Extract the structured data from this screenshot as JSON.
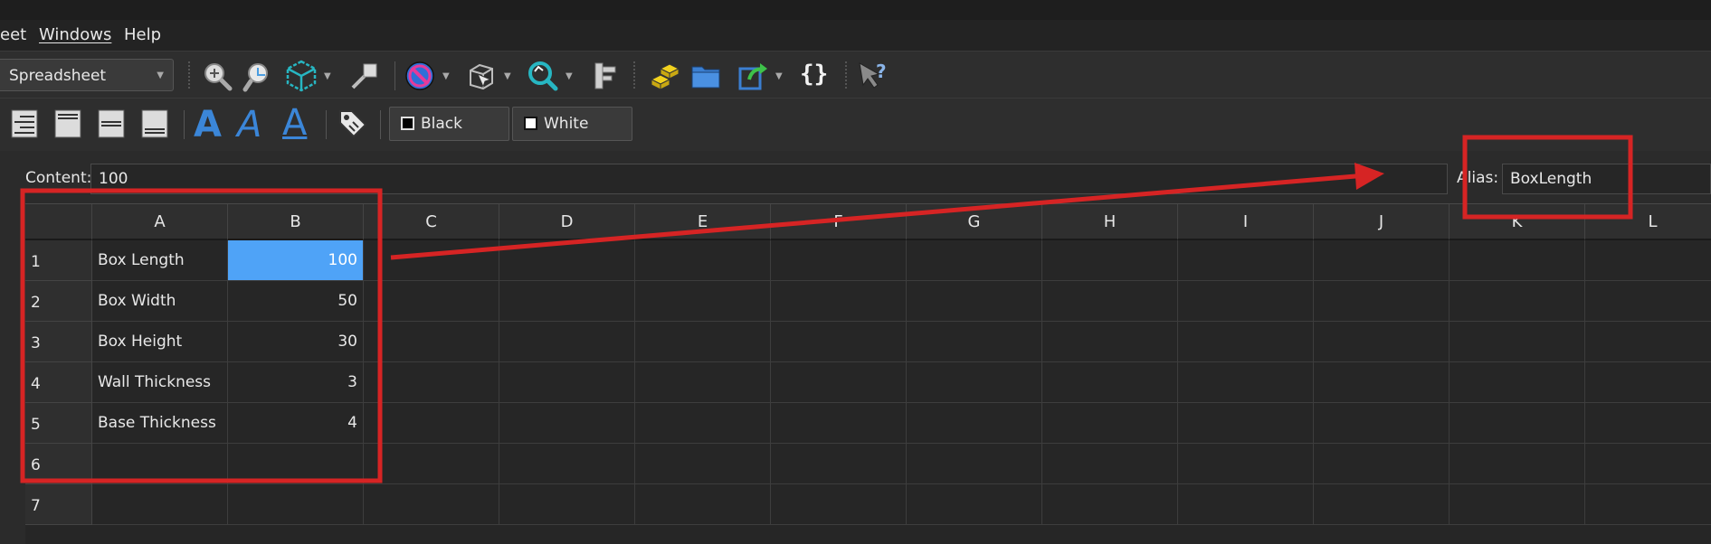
{
  "menubar": {
    "items": [
      "eet",
      "Windows",
      "Help"
    ]
  },
  "toolbar1": {
    "workbench_selector": "Spreadsheet",
    "icons": [
      "zoom-fit-icon",
      "zoom-selection-icon",
      "isometric-view-icon",
      "link-icon",
      "draw-style-icon",
      "bounding-box-icon",
      "refresh-icon",
      "measure-icon",
      "parts-icon",
      "folder-icon",
      "export-icon",
      "macro-braces-icon",
      "whats-this-icon"
    ]
  },
  "toolbar2": {
    "black_label": "Black",
    "white_label": "White",
    "colors": {
      "black": "#000000",
      "white": "#ffffff"
    }
  },
  "content_row": {
    "content_label": "Content:",
    "content_value": "100",
    "alias_label": "Alias:",
    "alias_value": "BoxLength"
  },
  "grid": {
    "columns": [
      "A",
      "B",
      "C",
      "D",
      "E",
      "F",
      "G",
      "H",
      "I",
      "J",
      "K",
      "L"
    ],
    "rows": [
      "1",
      "2",
      "3",
      "4",
      "5",
      "6",
      "7"
    ],
    "cells": [
      [
        "Box Length",
        "100"
      ],
      [
        "Box Width",
        "50"
      ],
      [
        "Box Height",
        "30"
      ],
      [
        "Wall Thickness",
        "3"
      ],
      [
        "Base Thickness",
        "4"
      ],
      [
        "",
        ""
      ],
      [
        "",
        ""
      ]
    ],
    "selected_cell": "B1"
  },
  "annotation_color": "#d62424",
  "selection_color": "#4fa3f7"
}
